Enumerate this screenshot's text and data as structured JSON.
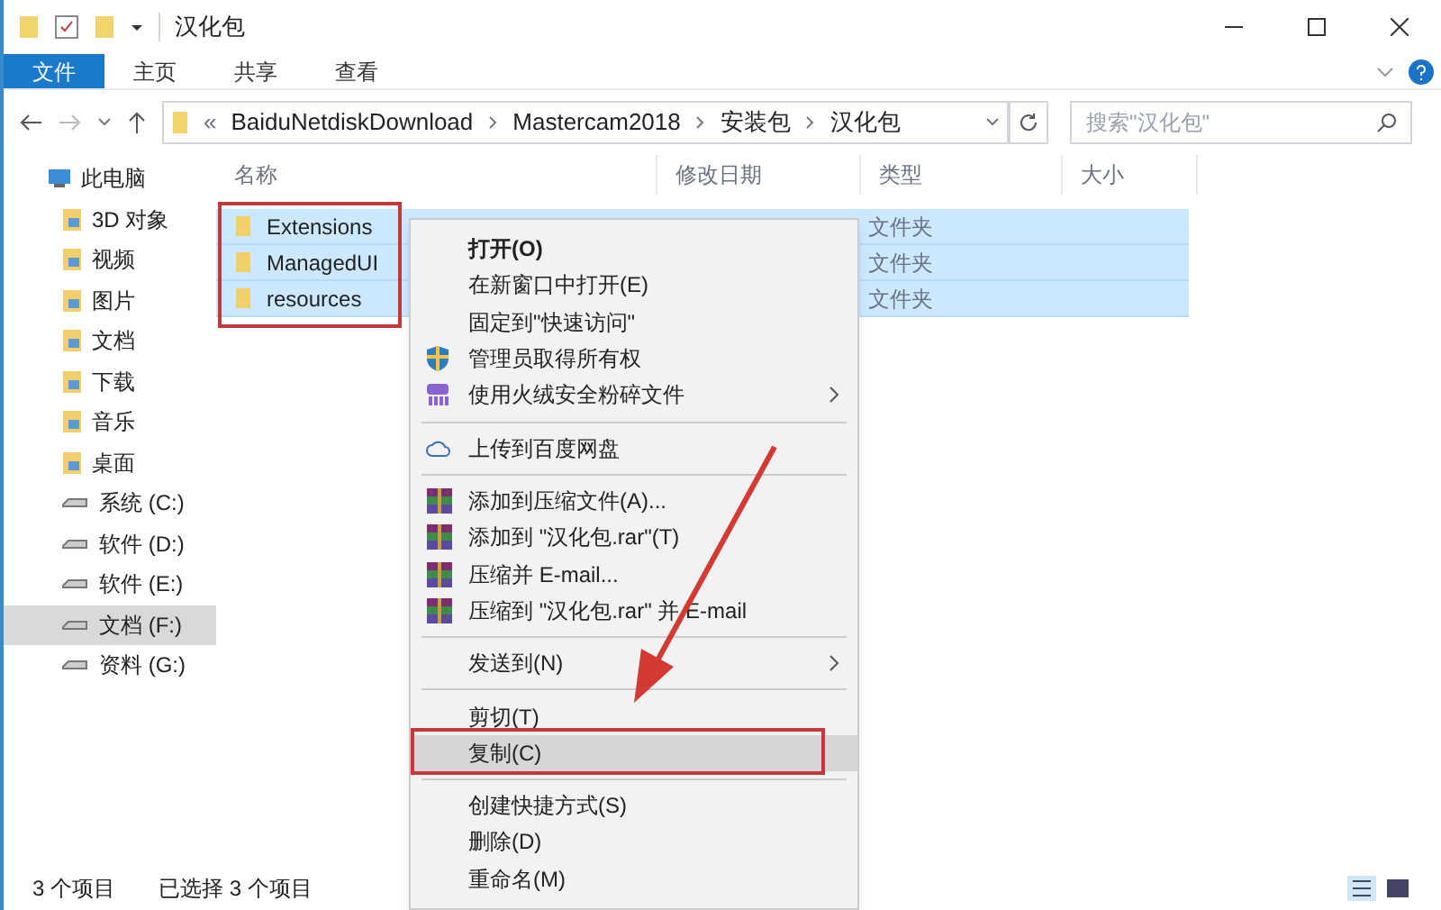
{
  "window": {
    "title": "汉化包"
  },
  "ribbon_tabs": [
    {
      "label": "文件",
      "selected": true
    },
    {
      "label": "主页",
      "selected": false
    },
    {
      "label": "共享",
      "selected": false
    },
    {
      "label": "查看",
      "selected": false
    }
  ],
  "address": {
    "overflow": "«",
    "path": [
      "BaiduNetdiskDownload",
      "Mastercam2018",
      "安装包",
      "汉化包"
    ]
  },
  "search": {
    "placeholder": "搜索\"汉化包\""
  },
  "columns": [
    "名称",
    "修改日期",
    "类型",
    "大小"
  ],
  "sidebar": {
    "items": [
      {
        "label": "此电脑",
        "kind": "pc",
        "selected": false,
        "children": [
          {
            "label": "3D 对象",
            "kind": "folder",
            "selected": false
          },
          {
            "label": "视频",
            "kind": "folder",
            "selected": false
          },
          {
            "label": "图片",
            "kind": "folder",
            "selected": false
          },
          {
            "label": "文档",
            "kind": "folder",
            "selected": false
          },
          {
            "label": "下载",
            "kind": "folder",
            "selected": false
          },
          {
            "label": "音乐",
            "kind": "folder",
            "selected": false
          },
          {
            "label": "桌面",
            "kind": "folder",
            "selected": false
          },
          {
            "label": "系统 (C:)",
            "kind": "drive",
            "selected": false
          },
          {
            "label": "软件 (D:)",
            "kind": "drive",
            "selected": false
          },
          {
            "label": "软件 (E:)",
            "kind": "drive",
            "selected": false
          },
          {
            "label": "文档 (F:)",
            "kind": "drive",
            "selected": true
          },
          {
            "label": "资料 (G:)",
            "kind": "drive",
            "selected": false
          }
        ]
      }
    ]
  },
  "files": [
    {
      "name": "Extensions",
      "type": "文件夹",
      "selected": true
    },
    {
      "name": "ManagedUI",
      "type": "文件夹",
      "selected": true
    },
    {
      "name": "resources",
      "type": "文件夹",
      "selected": true
    }
  ],
  "context_menu": [
    {
      "kind": "plain",
      "label": "打开(O)",
      "bold": true,
      "submenu": false,
      "selected": false
    },
    {
      "kind": "plain",
      "label": "在新窗口中打开(E)",
      "bold": false,
      "submenu": false,
      "selected": false
    },
    {
      "kind": "plain",
      "label": "固定到\"快速访问\"",
      "bold": false,
      "submenu": false,
      "selected": false
    },
    {
      "kind": "shield",
      "label": "管理员取得所有权",
      "bold": false,
      "submenu": false,
      "selected": false
    },
    {
      "kind": "shredder",
      "label": "使用火绒安全粉碎文件",
      "bold": false,
      "submenu": true,
      "selected": false
    },
    {
      "kind": "separator"
    },
    {
      "kind": "cloud",
      "label": "上传到百度网盘",
      "bold": false,
      "submenu": false,
      "selected": false
    },
    {
      "kind": "separator"
    },
    {
      "kind": "archive",
      "label": "添加到压缩文件(A)...",
      "bold": false,
      "submenu": false,
      "selected": false
    },
    {
      "kind": "archive",
      "label": "添加到 \"汉化包.rar\"(T)",
      "bold": false,
      "submenu": false,
      "selected": false
    },
    {
      "kind": "archive",
      "label": "压缩并 E-mail...",
      "bold": false,
      "submenu": false,
      "selected": false
    },
    {
      "kind": "archive",
      "label": "压缩到 \"汉化包.rar\" 并 E-mail",
      "bold": false,
      "submenu": false,
      "selected": false
    },
    {
      "kind": "separator"
    },
    {
      "kind": "plain",
      "label": "发送到(N)",
      "bold": false,
      "submenu": true,
      "selected": false
    },
    {
      "kind": "separator"
    },
    {
      "kind": "plain",
      "label": "剪切(T)",
      "bold": false,
      "submenu": false,
      "selected": false
    },
    {
      "kind": "plain",
      "label": "复制(C)",
      "bold": false,
      "submenu": false,
      "selected": true
    },
    {
      "kind": "separator"
    },
    {
      "kind": "plain",
      "label": "创建快捷方式(S)",
      "bold": false,
      "submenu": false,
      "selected": false
    },
    {
      "kind": "plain",
      "label": "删除(D)",
      "bold": false,
      "submenu": false,
      "selected": false
    },
    {
      "kind": "plain",
      "label": "重命名(M)",
      "bold": false,
      "submenu": false,
      "selected": false
    }
  ],
  "status_bar": {
    "count": "3 个项目",
    "selection": "已选择 3 个项目"
  }
}
